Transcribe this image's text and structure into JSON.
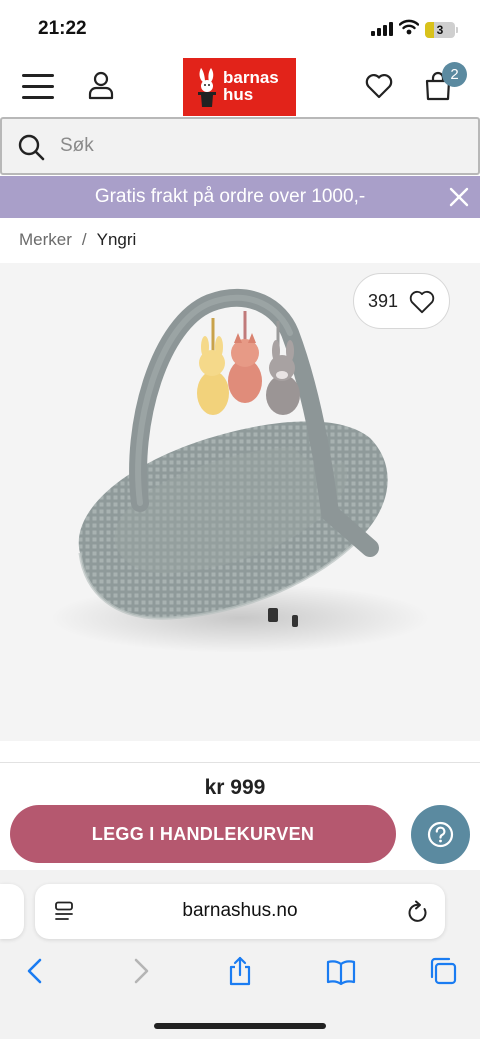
{
  "status_bar": {
    "time": "21:22",
    "battery": "3"
  },
  "header": {
    "logo_line1": "barnas",
    "logo_line2": "hus",
    "cart_count": "2",
    "logo_color": "#e2231a",
    "accent_color": "#5b8aa0"
  },
  "search": {
    "placeholder": "Søk",
    "value": ""
  },
  "promo": {
    "text": "Gratis frakt på ordre over 1000,-",
    "background": "#a99fc9"
  },
  "breadcrumb": {
    "items": [
      "Merker",
      "Yngri"
    ],
    "separator": "/"
  },
  "product": {
    "favorite_count": "391",
    "price": "kr 999",
    "add_to_cart_label": "LEGG I HANDLEKURVEN",
    "button_color": "#b5586f"
  },
  "browser": {
    "url": "barnashus.no"
  },
  "icons": [
    "menu-icon",
    "account-icon",
    "heart-icon",
    "cart-icon",
    "search-icon",
    "close-icon",
    "help-icon",
    "reader-icon",
    "reload-icon",
    "back-icon",
    "forward-icon",
    "share-icon",
    "bookmarks-icon",
    "tabs-icon"
  ]
}
